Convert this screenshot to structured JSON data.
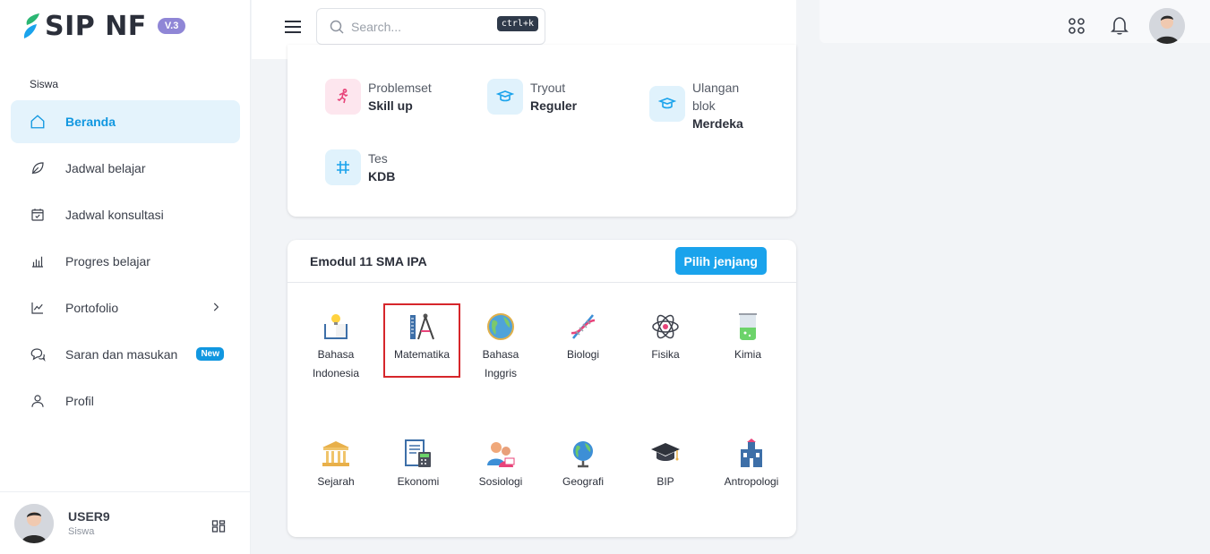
{
  "brand": {
    "name": "SIP NF",
    "version": "V.3"
  },
  "sidebar": {
    "section_label": "Siswa",
    "items": [
      {
        "label": "Beranda",
        "icon": "home-icon",
        "active": true
      },
      {
        "label": "Jadwal belajar",
        "icon": "leaf-icon"
      },
      {
        "label": "Jadwal konsultasi",
        "icon": "calendar-check-icon"
      },
      {
        "label": "Progres belajar",
        "icon": "bar-chart-icon"
      },
      {
        "label": "Portofolio",
        "icon": "trend-chart-icon",
        "has_submenu": true
      },
      {
        "label": "Saran dan masukan",
        "icon": "chat-bubbles-icon",
        "badge": "New"
      },
      {
        "label": "Profil",
        "icon": "user-icon"
      }
    ],
    "user": {
      "name": "USER9",
      "role": "Siswa"
    }
  },
  "header": {
    "search_placeholder": "Search...",
    "shortcut": "ctrl+k"
  },
  "tasks": [
    {
      "label": "Problemset",
      "sub": "Skill up",
      "icon": "running-person-icon",
      "color": "#e8447a"
    },
    {
      "label": "Tryout",
      "sub": "Reguler",
      "icon": "graduation-cap-icon",
      "color": "#1aa3ec"
    },
    {
      "label": "Ulangan blok",
      "sub": "Merdeka",
      "icon": "graduation-cap-icon",
      "color": "#1aa3ec"
    },
    {
      "label": "Tes",
      "sub": "KDB",
      "icon": "hash-grid-icon",
      "color": "#1aa3ec"
    }
  ],
  "emodul": {
    "title": "Emodul 11 SMA IPA",
    "button": "Pilih jenjang",
    "subjects": [
      {
        "label": "Bahasa Indonesia",
        "icon": "book-lightbulb-icon"
      },
      {
        "label": "Matematika",
        "icon": "ruler-compass-icon",
        "selected": true
      },
      {
        "label": "Bahasa Inggris",
        "icon": "globe-icon"
      },
      {
        "label": "Biologi",
        "icon": "dna-icon"
      },
      {
        "label": "Fisika",
        "icon": "atom-icon"
      },
      {
        "label": "Kimia",
        "icon": "beaker-icon"
      },
      {
        "label": "Sejarah",
        "icon": "temple-icon"
      },
      {
        "label": "Ekonomi",
        "icon": "calculator-document-icon"
      },
      {
        "label": "Sosiologi",
        "icon": "people-icon"
      },
      {
        "label": "Geografi",
        "icon": "earth-globe-icon"
      },
      {
        "label": "BIP",
        "icon": "mortarboard-icon"
      },
      {
        "label": "Antropologi",
        "icon": "building-icon"
      }
    ]
  }
}
